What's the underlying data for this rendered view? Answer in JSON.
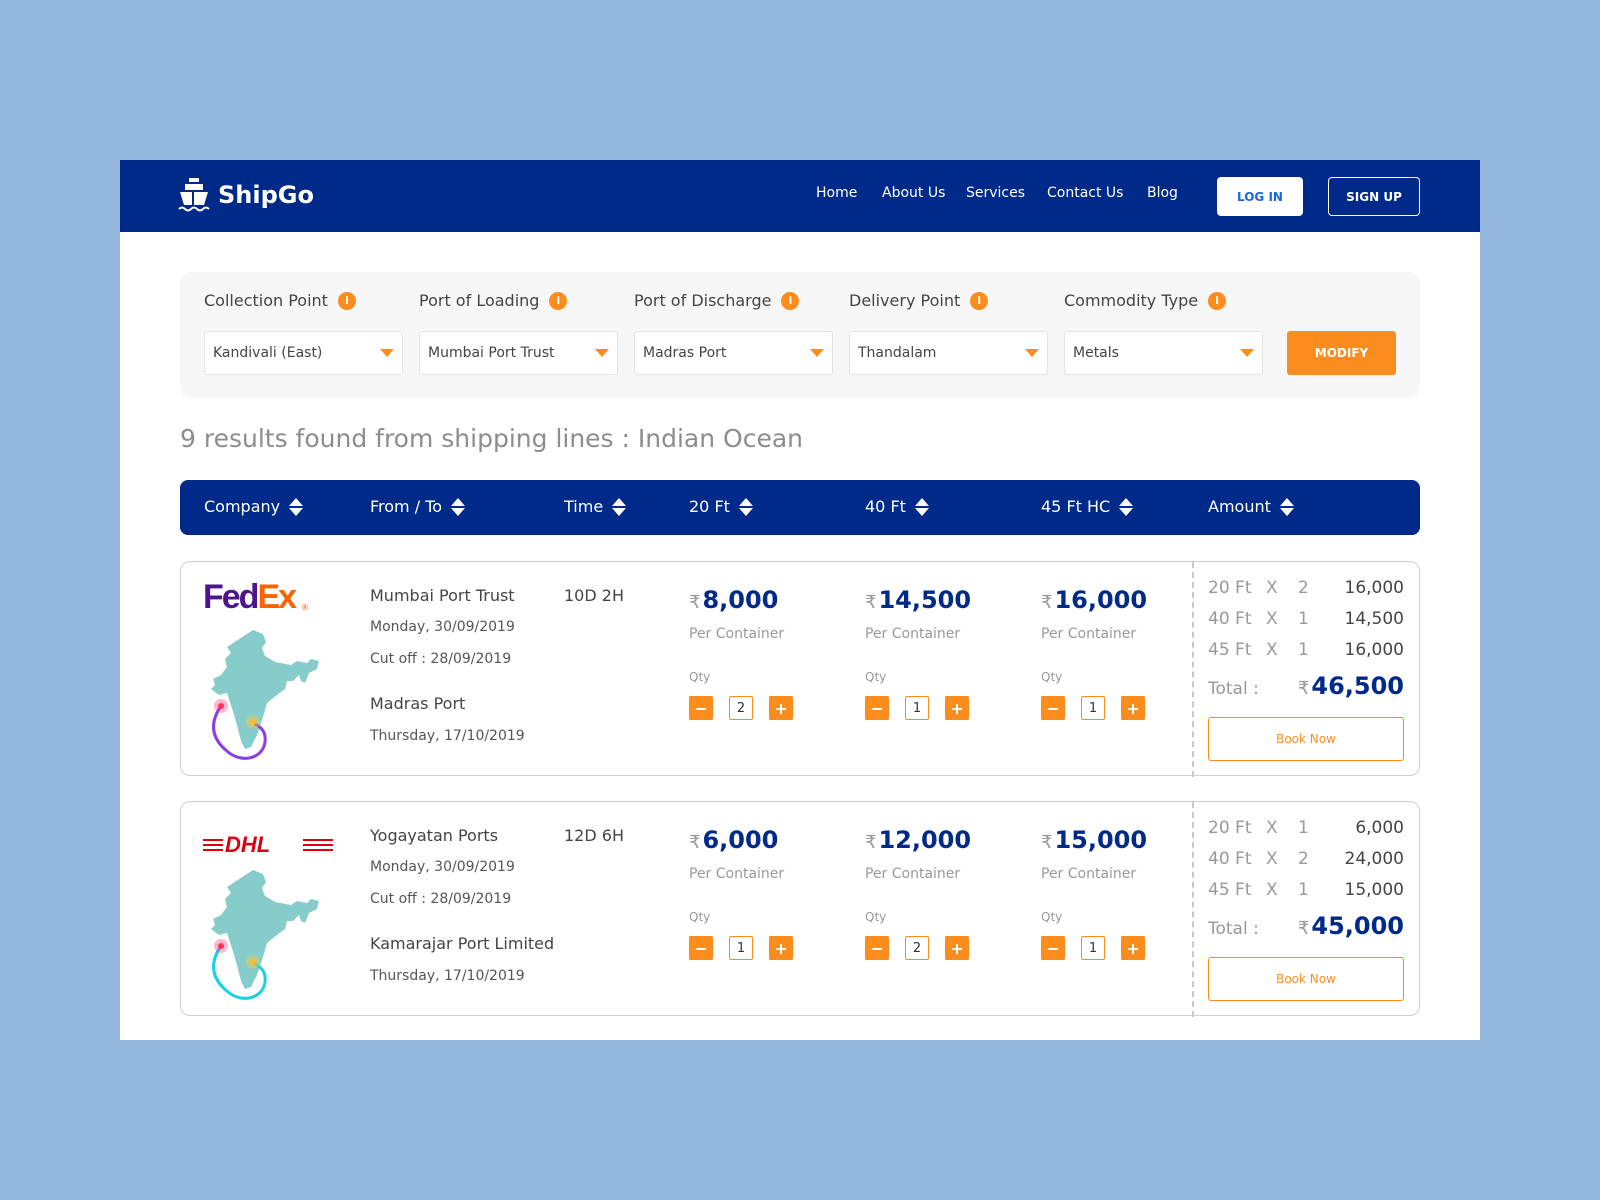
{
  "brand": {
    "name": "ShipGo"
  },
  "nav": [
    "Home",
    "About Us",
    "Services",
    "Contact Us",
    "Blog"
  ],
  "auth": {
    "login": "LOG IN",
    "signup": "SIGN UP"
  },
  "filters": [
    {
      "label": "Collection Point",
      "value": "Kandivali (East)"
    },
    {
      "label": "Port of Loading",
      "value": "Mumbai Port Trust"
    },
    {
      "label": "Port of Discharge",
      "value": "Madras Port"
    },
    {
      "label": "Delivery Point",
      "value": "Thandalam"
    },
    {
      "label": "Commodity Type",
      "value": "Metals"
    }
  ],
  "info_glyph": "i",
  "modify": "MODIFY",
  "results_text": "9 results found from shipping lines : Indian Ocean",
  "columns": [
    "Company",
    "From / To",
    "Time",
    "20 Ft",
    "40 Ft",
    "45 Ft HC",
    "Amount"
  ],
  "currency": "₹",
  "labels": {
    "per_container": "Per Container",
    "qty": "Qty",
    "total": "Total :",
    "book": "Book Now",
    "x": "X",
    "minus": "−",
    "plus": "+"
  },
  "results": [
    {
      "company": "FedEx",
      "route_color": "#8a3fe0",
      "from": "Mumbai Port Trust",
      "from_date": "Monday, 30/09/2019",
      "cutoff": "Cut off : 28/09/2019",
      "to": "Madras Port",
      "to_date": "Thursday, 17/10/2019",
      "time": "10D 2H",
      "prices": [
        {
          "price": "8,000",
          "qty": "2"
        },
        {
          "price": "14,500",
          "qty": "1"
        },
        {
          "price": "16,000",
          "qty": "1"
        }
      ],
      "summary": [
        {
          "size": "20 Ft",
          "qty": "2",
          "amount": "16,000"
        },
        {
          "size": "40 Ft",
          "qty": "1",
          "amount": "14,500"
        },
        {
          "size": "45 Ft",
          "qty": "1",
          "amount": "16,000"
        }
      ],
      "total": "46,500"
    },
    {
      "company": "DHL",
      "route_color": "#1ad1e0",
      "from": "Yogayatan Ports",
      "from_date": "Monday, 30/09/2019",
      "cutoff": "Cut off : 28/09/2019",
      "to": "Kamarajar Port Limited",
      "to_date": "Thursday, 17/10/2019",
      "time": "12D 6H",
      "prices": [
        {
          "price": "6,000",
          "qty": "1"
        },
        {
          "price": "12,000",
          "qty": "2"
        },
        {
          "price": "15,000",
          "qty": "1"
        }
      ],
      "summary": [
        {
          "size": "20 Ft",
          "qty": "1",
          "amount": "6,000"
        },
        {
          "size": "40 Ft",
          "qty": "2",
          "amount": "24,000"
        },
        {
          "size": "45 Ft",
          "qty": "1",
          "amount": "15,000"
        }
      ],
      "total": "45,000"
    }
  ],
  "colors": {
    "primary": "#002a8a",
    "accent": "#fb8c1e",
    "background": "#95b6dc"
  }
}
